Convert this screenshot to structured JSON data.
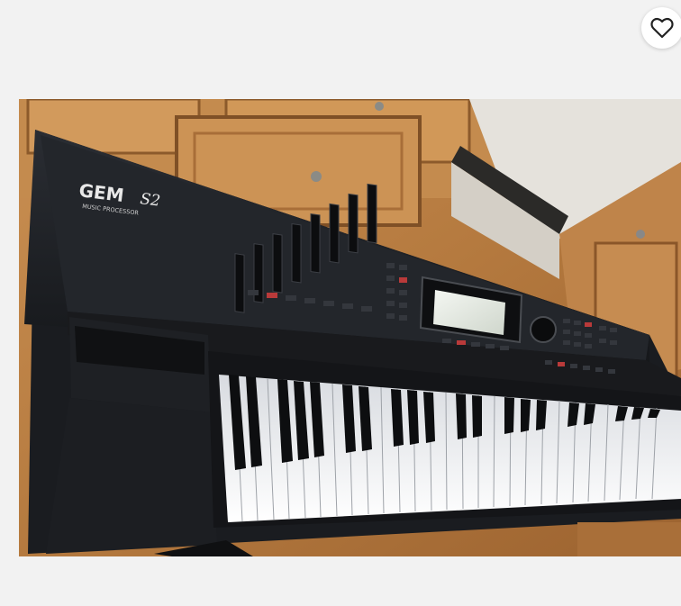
{
  "listing": {
    "image_alt": "GEM S2 Music Processor keyboard",
    "brand_logo_text": "GEM",
    "model_logo_text": "S2",
    "logo_subtitle": "MUSIC PROCESSOR"
  },
  "favorite": {
    "icon": "heart-outline-icon",
    "aria_label": "Add to favorites"
  },
  "colors": {
    "page_background": "#f2f2f2",
    "wood": "#b57a3f",
    "keyboard_body": "#1c1e22"
  }
}
